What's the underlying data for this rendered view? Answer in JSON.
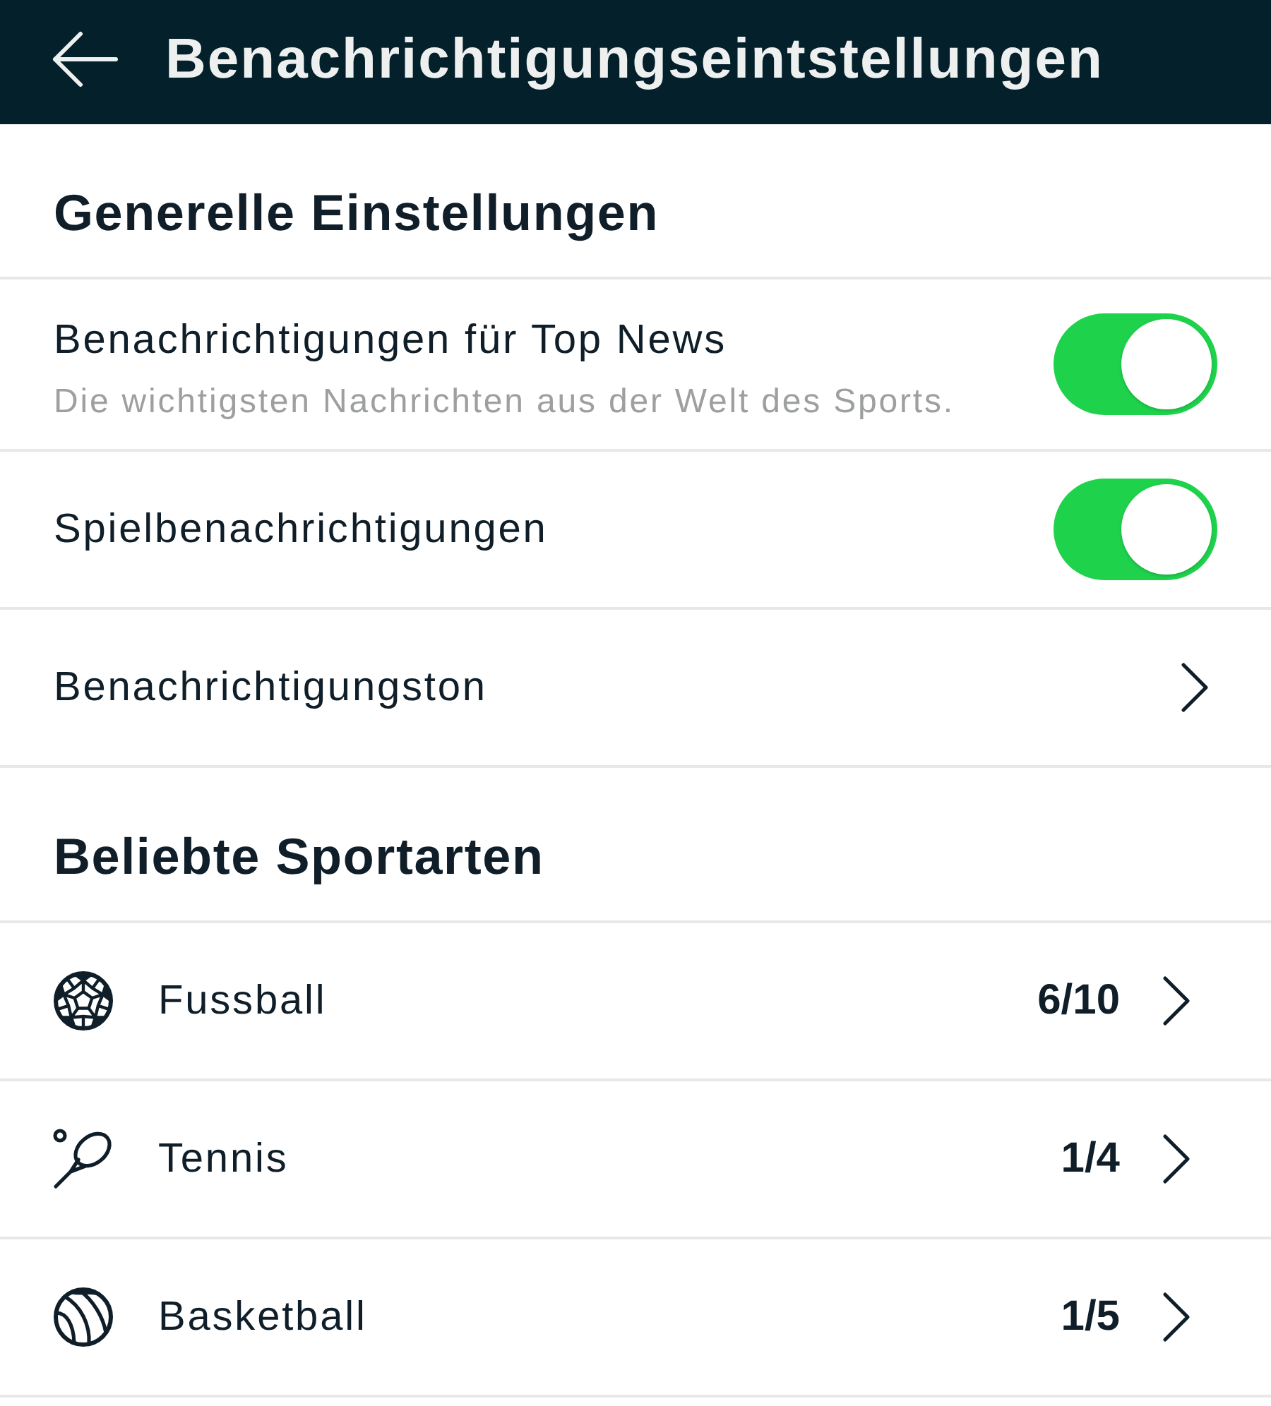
{
  "header": {
    "title": "Benachrichtigungseintstellungen"
  },
  "sections": [
    {
      "title": "Generelle Einstellungen",
      "items": [
        {
          "kind": "toggle",
          "label": "Benachrichtigungen für Top News",
          "description": "Die wichtigsten Nachrichten aus der Welt des Sports.",
          "on": true
        },
        {
          "kind": "toggle",
          "label": "Spielbenachrichtigungen",
          "on": true
        },
        {
          "kind": "link",
          "label": "Benachrichtigungston"
        }
      ]
    },
    {
      "title": "Beliebte Sportarten",
      "items": [
        {
          "kind": "sport",
          "label": "Fussball",
          "count": "6/10"
        },
        {
          "kind": "sport",
          "label": "Tennis",
          "count": "1/4"
        },
        {
          "kind": "sport",
          "label": "Basketball",
          "count": "1/5"
        }
      ]
    }
  ]
}
